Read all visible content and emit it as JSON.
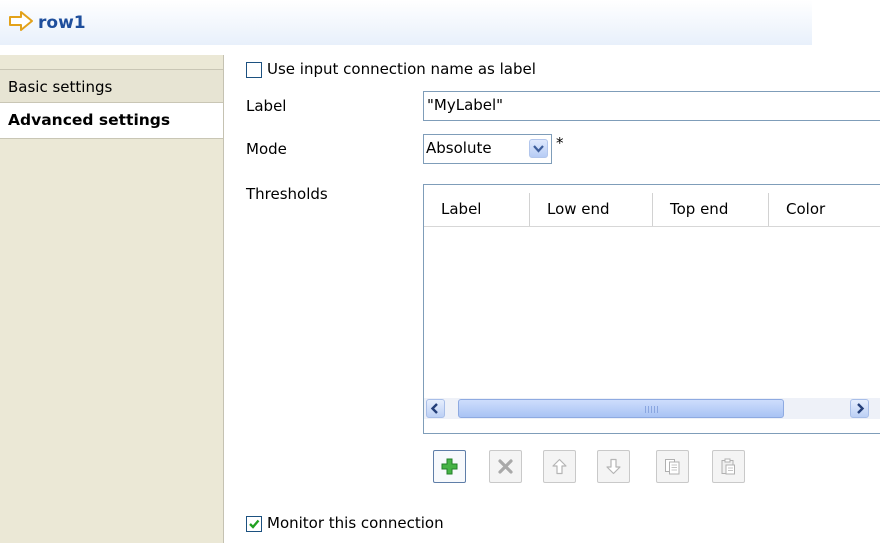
{
  "header": {
    "title": "row1"
  },
  "sidebar": {
    "tabs": [
      {
        "label": "Basic settings"
      },
      {
        "label": "Advanced settings"
      }
    ]
  },
  "form": {
    "use_input_name": {
      "label": "Use input connection name as label",
      "checked": false
    },
    "label_field": {
      "label": "Label",
      "value": "\"MyLabel\""
    },
    "mode": {
      "label": "Mode",
      "value": "Absolute",
      "required_marker": "*"
    },
    "thresholds": {
      "label": "Thresholds",
      "columns": [
        "Label",
        "Low end",
        "Top end",
        "Color"
      ],
      "rows": []
    },
    "monitor": {
      "label": "Monitor this connection",
      "checked": true
    }
  },
  "toolbar": {
    "buttons": [
      {
        "name": "add-icon",
        "enabled": true
      },
      {
        "name": "delete-icon",
        "enabled": false
      },
      {
        "name": "move-up-icon",
        "enabled": false
      },
      {
        "name": "move-down-icon",
        "enabled": false
      },
      {
        "name": "copy-icon",
        "enabled": false
      },
      {
        "name": "paste-icon",
        "enabled": false
      }
    ]
  },
  "colors": {
    "accent": "#1e4e9c",
    "sidebar": "#ebe8d6",
    "add_green": "#3aa13a",
    "disabled_gray": "#b9b9b9"
  }
}
